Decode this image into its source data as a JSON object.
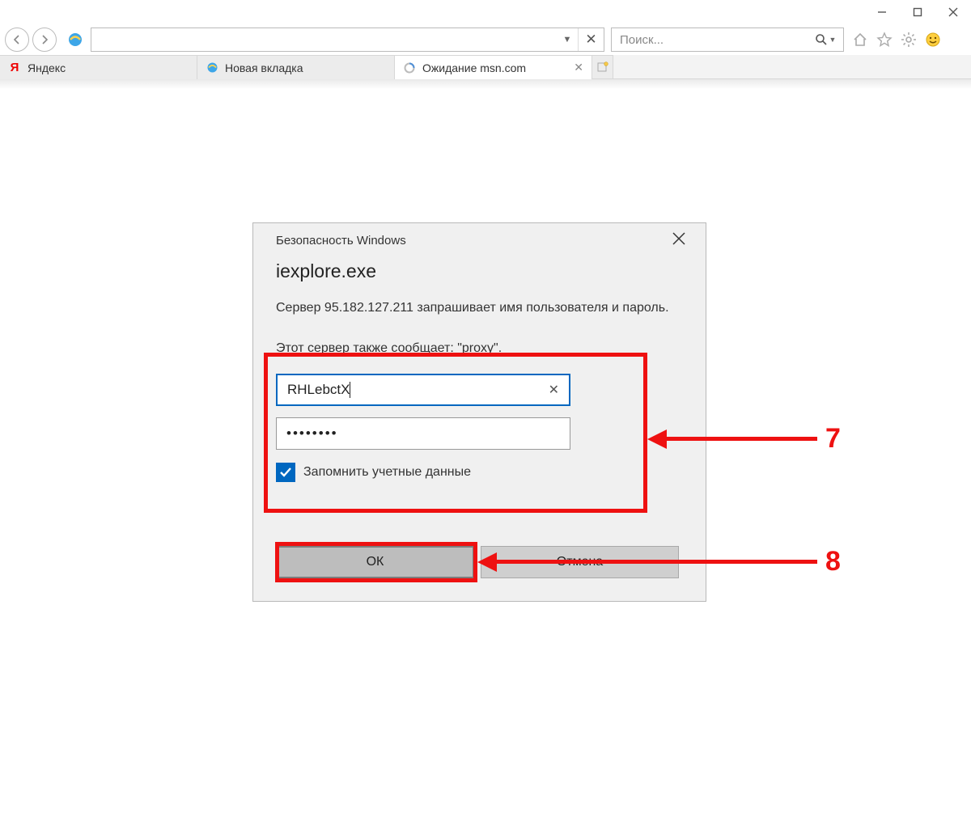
{
  "window_controls": {
    "minimize": "–",
    "maximize": "□",
    "close": "×"
  },
  "address_bar": {
    "value": "",
    "dropdown": "▼",
    "stop": "✕"
  },
  "search": {
    "placeholder": "Поиск..."
  },
  "tabs": [
    {
      "label": "Яндекс"
    },
    {
      "label": "Новая вкладка"
    },
    {
      "label": "Ожидание msn.com",
      "active": true
    }
  ],
  "dialog": {
    "title": "Безопасность Windows",
    "app": "iexplore.exe",
    "message1": "Сервер 95.182.127.211 запрашивает имя пользователя и пароль.",
    "message2": "Этот сервер также сообщает: \"proxy\".",
    "username": "RHLebctX",
    "password": "••••••••",
    "remember_label": "Запомнить учетные данные",
    "ok_label": "ОК",
    "cancel_label": "Отмена"
  },
  "annotations": {
    "num1": "7",
    "num2": "8"
  }
}
